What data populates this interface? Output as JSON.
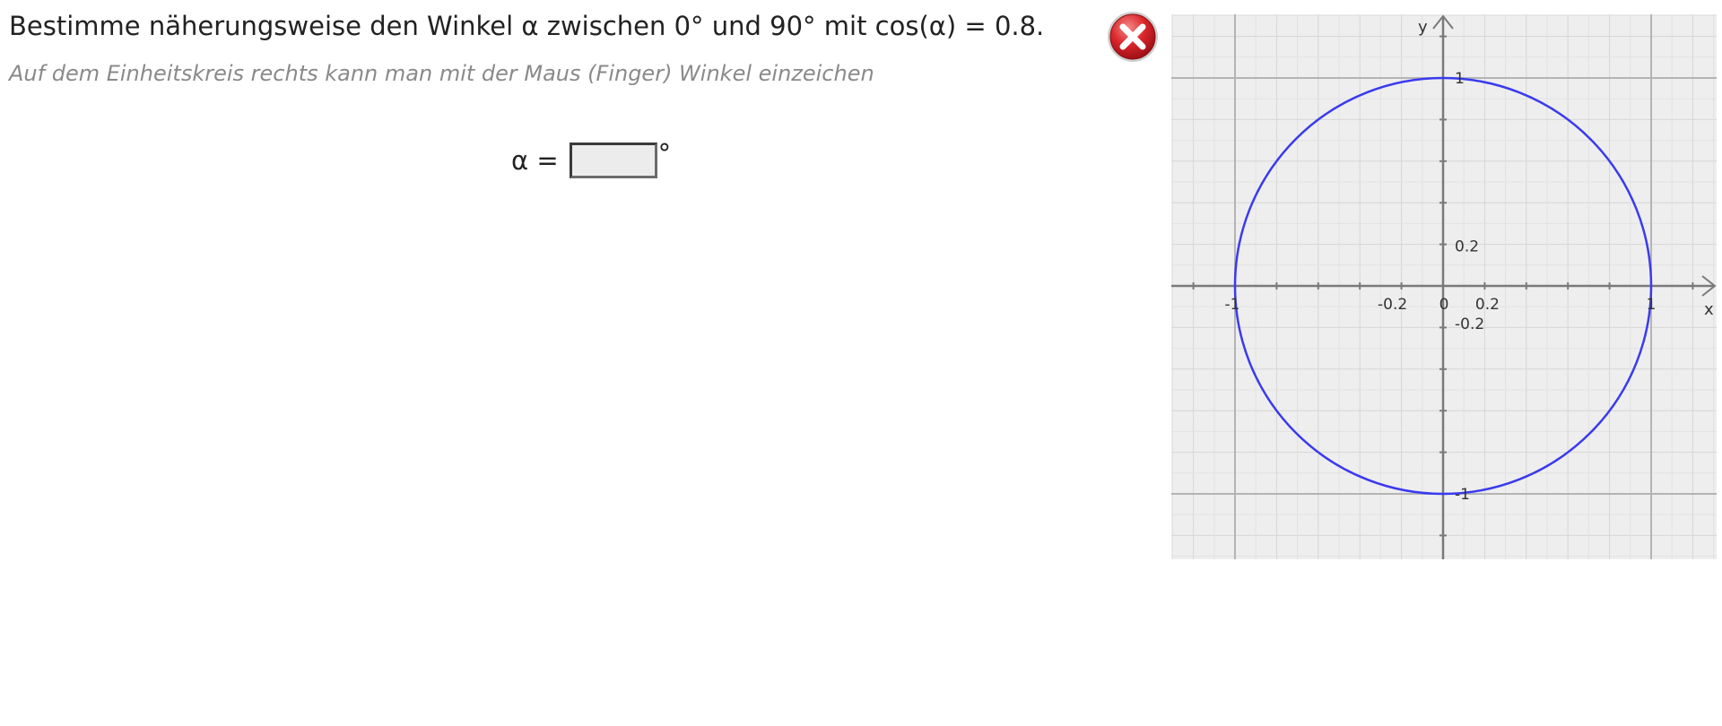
{
  "task": {
    "text": "Bestimme näherungsweise den Winkel α zwischen 0° und 90° mit cos(α) = 0.8.",
    "hint": "Auf dem Einheitskreis rechts kann man mit der Maus (Finger) Winkel einzeichen"
  },
  "answer": {
    "label": "α =",
    "value": "",
    "suffix": "°"
  },
  "close_button": {
    "icon": "close-icon",
    "color": "#d9252a"
  },
  "unit_circle": {
    "x_axis_label": "x",
    "y_axis_label": "y",
    "circle_color": "#3a3af0",
    "x_range": [
      -1.3,
      1.3
    ],
    "y_range": [
      -1.3,
      1.3
    ],
    "grid_step": 0.1,
    "major_grid_step": 1,
    "tick_labels": [
      {
        "text": "1",
        "x": 0,
        "y": 1
      },
      {
        "text": "0.2",
        "x": 0,
        "y": 0.2
      },
      {
        "text": "-1",
        "x": -1,
        "y": 0
      },
      {
        "text": "-0.2",
        "x": -0.2,
        "y": 0
      },
      {
        "text": "0",
        "x": 0,
        "y": 0
      },
      {
        "text": "0.2",
        "x": 0.2,
        "y": 0
      },
      {
        "text": "-0.2",
        "x": 0,
        "y": -0.2
      },
      {
        "text": "1",
        "x": 1,
        "y": 0
      },
      {
        "text": "-1",
        "x": 0,
        "y": -1
      }
    ]
  }
}
